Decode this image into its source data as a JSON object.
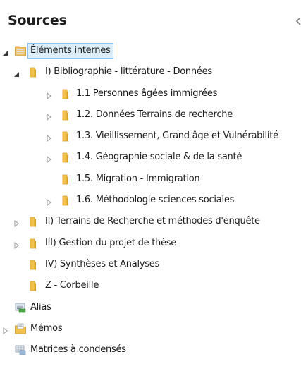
{
  "panel": {
    "title": "Sources",
    "collapse_icon": "chevron-left-icon"
  },
  "tree": [
    {
      "label": "Éléments internes",
      "level": 0,
      "state": "expanded",
      "icon": "internal-sources-icon",
      "selected": true
    },
    {
      "label": "I) Bibliographie - littérature - Données",
      "level": 1,
      "state": "expanded",
      "icon": "folder-icon"
    },
    {
      "label": "1.1 Personnes âgées immigrées",
      "level": 2,
      "state": "collapsed",
      "icon": "folder-icon"
    },
    {
      "label": "1.2. Données Terrains de recherche",
      "level": 2,
      "state": "collapsed",
      "icon": "folder-icon"
    },
    {
      "label": "1.3. Vieillissement, Grand âge et Vulnérabilité",
      "level": 2,
      "state": "collapsed",
      "icon": "folder-icon"
    },
    {
      "label": "1.4. Géographie sociale & de la santé",
      "level": 2,
      "state": "collapsed",
      "icon": "folder-icon"
    },
    {
      "label": "1.5. Migration - Immigration",
      "level": 2,
      "state": "none",
      "icon": "folder-icon"
    },
    {
      "label": "1.6. Méthodologie sciences sociales",
      "level": 2,
      "state": "collapsed",
      "icon": "folder-icon"
    },
    {
      "label": "II) Terrains de Recherche et méthodes d'enquête",
      "level": 1,
      "state": "collapsed",
      "icon": "folder-icon"
    },
    {
      "label": "III) Gestion du projet de thèse",
      "level": 1,
      "state": "collapsed",
      "icon": "folder-icon"
    },
    {
      "label": "IV) Synthèses et Analyses",
      "level": 1,
      "state": "none",
      "icon": "folder-icon"
    },
    {
      "label": "Z - Corbeille",
      "level": 1,
      "state": "none",
      "icon": "folder-icon"
    },
    {
      "label": "Alias",
      "level": 0,
      "state": "none",
      "icon": "alias-icon"
    },
    {
      "label": "Mémos",
      "level": 0,
      "state": "collapsed",
      "icon": "memo-folder-icon"
    },
    {
      "label": "Matrices à condensés",
      "level": 0,
      "state": "none",
      "icon": "matrix-icon"
    }
  ],
  "colors": {
    "folder": "#f2c14e",
    "folder_dark": "#d9a028",
    "selection_bg": "#ddeefb",
    "selection_border": "#8fc3ee",
    "arrow_collapsed": "#a0a0a0",
    "arrow_expanded": "#3c3c3c"
  }
}
